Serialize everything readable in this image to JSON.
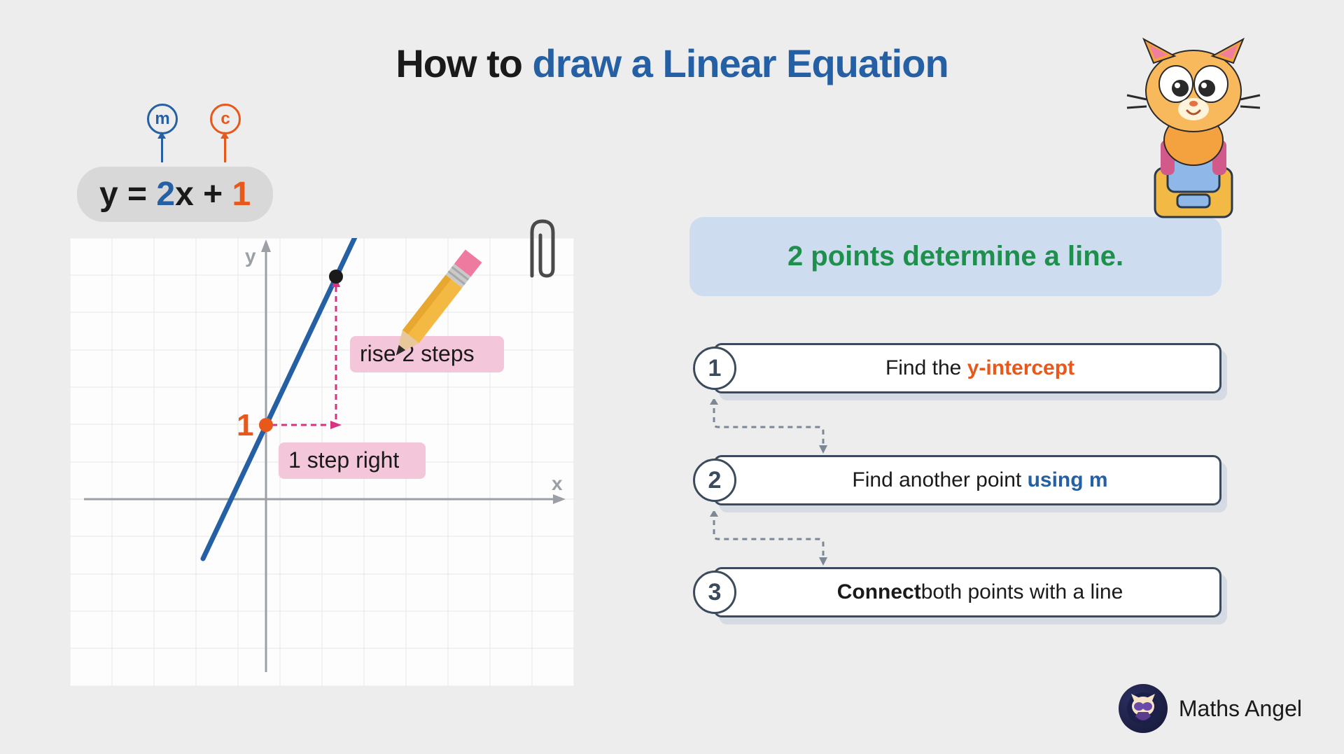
{
  "title": {
    "prefix": "How to ",
    "highlight": "draw a Linear Equation"
  },
  "equation": {
    "m_label": "m",
    "c_label": "c",
    "lhs": "y = ",
    "m_value": "2",
    "x_plus": "x + ",
    "c_value": "1"
  },
  "graph": {
    "y_axis_label": "y",
    "x_axis_label": "x",
    "intercept_label": "1",
    "note_rise": "rise 2 steps",
    "note_run": "1 step right"
  },
  "concept": "2 points determine a line.",
  "steps": [
    {
      "num": "1",
      "prefix": "Find the ",
      "kw": "y-intercept",
      "kw_class": "kw-orange",
      "suffix": ""
    },
    {
      "num": "2",
      "prefix": "Find another point ",
      "kw": "using m",
      "kw_class": "kw-blue",
      "suffix": ""
    },
    {
      "num": "3",
      "bold": "Connect",
      "rest": " both points with a line"
    }
  ],
  "brand": "Maths Angel"
}
